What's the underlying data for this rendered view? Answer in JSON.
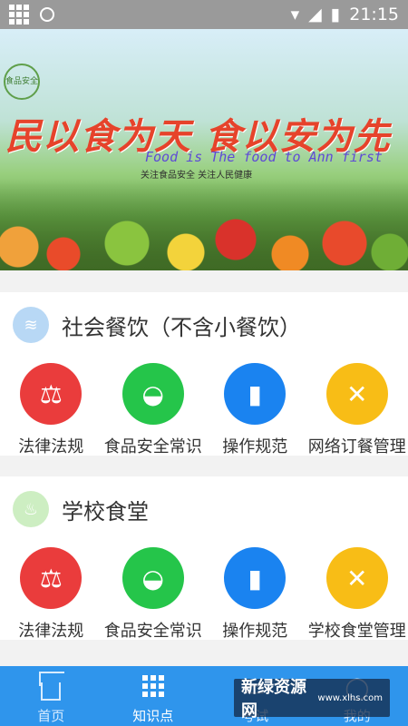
{
  "status_bar": {
    "time": "21:15"
  },
  "banner": {
    "logo_text": "食品安全",
    "headline": "民以食为天 食以安为先",
    "subline": "Food is The food to Ann first",
    "tagline": "关注食品安全  关注人民健康"
  },
  "sections": [
    {
      "title": "社会餐饮（不含小餐饮）",
      "icon": "bowl-icon",
      "items": [
        {
          "label": "法律法规",
          "icon": "scale-icon",
          "color": "#ea3c3c"
        },
        {
          "label": "食品安全常识",
          "icon": "bowl-spoon-icon",
          "color": "#25c54a"
        },
        {
          "label": "操作规范",
          "icon": "book-icon",
          "color": "#1a83f0"
        },
        {
          "label": "网络订餐管理",
          "icon": "tools-icon",
          "color": "#f8bd16"
        }
      ]
    },
    {
      "title": "学校食堂",
      "icon": "pot-icon",
      "items": [
        {
          "label": "法律法规",
          "icon": "scale-icon",
          "color": "#ea3c3c"
        },
        {
          "label": "食品安全常识",
          "icon": "bowl-spoon-icon",
          "color": "#25c54a"
        },
        {
          "label": "操作规范",
          "icon": "book-icon",
          "color": "#1a83f0"
        },
        {
          "label": "学校食堂管理",
          "icon": "tools-icon",
          "color": "#f8bd16"
        }
      ]
    }
  ],
  "tabbar": {
    "tabs": [
      {
        "label": "首页",
        "icon": "home-icon"
      },
      {
        "label": "知识点",
        "icon": "grid-icon",
        "active": true
      },
      {
        "label": "考试",
        "icon": "exam-icon"
      },
      {
        "label": "我的",
        "icon": "user-icon"
      }
    ]
  },
  "watermark": {
    "title": "新绿资源网",
    "url": "www.xlhs.com"
  },
  "colors": {
    "primary": "#2f95ec",
    "background": "#f2f2f2"
  }
}
